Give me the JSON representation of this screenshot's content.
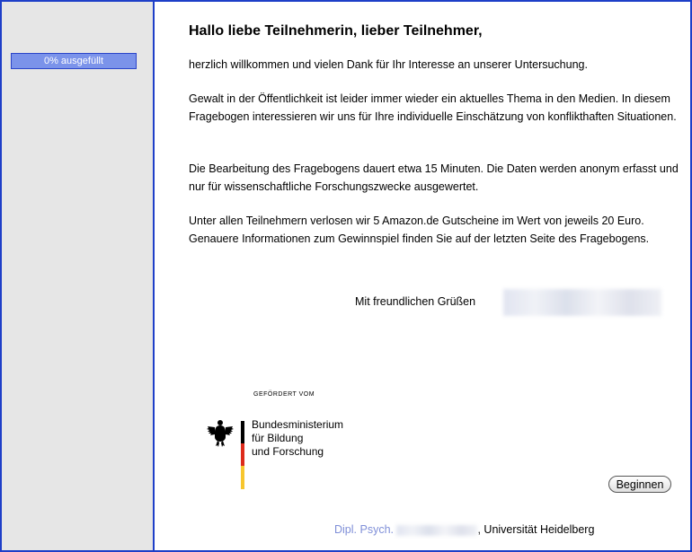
{
  "progress": {
    "label": "0% ausgefüllt",
    "value_percent": 0
  },
  "greeting": "Hallo liebe Teilnehmerin, lieber Teilnehmer,",
  "paragraphs": [
    "herzlich willkommen und vielen Dank für Ihr Interesse an unserer Untersuchung.",
    "Gewalt in der Öffentlichkeit ist leider immer wieder ein aktuelles Thema in den Medien. In diesem Fragebogen interessieren wir uns für Ihre individuelle Einschätzung von konflikthaften Situationen.",
    "Die Bearbeitung des Fragebogens dauert etwa 15 Minuten. Die Daten werden anonym erfasst und nur für wissenschaftliche Forschungszwecke ausgewertet.",
    "Unter allen Teilnehmern verlosen wir 5 Amazon.de Gutscheine im Wert von jeweils 20 Euro. Genauere Informationen zum Gewinnspiel finden Sie auf der letzten Seite des Fragebogens."
  ],
  "closing": "Mit freundlichen Grüßen",
  "sponsor": {
    "caption": "GEFÖRDERT VOM",
    "lines": [
      "Bundesministerium",
      "für Bildung",
      "und Forschung"
    ]
  },
  "buttons": {
    "begin": "Beginnen"
  },
  "footer": {
    "title": "Dipl. Psych.",
    "affiliation": ", Universität Heidelberg"
  },
  "colors": {
    "border": "#1e3fc8",
    "sidebar": "#e6e6e6",
    "progress_fill": "#7b93ea",
    "footer_title": "#7f8fd8"
  }
}
